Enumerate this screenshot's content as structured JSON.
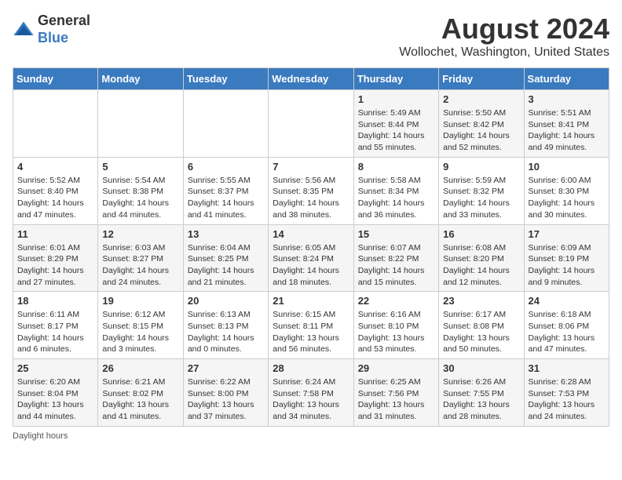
{
  "header": {
    "logo_line1": "General",
    "logo_line2": "Blue",
    "month_year": "August 2024",
    "location": "Wollochet, Washington, United States"
  },
  "weekdays": [
    "Sunday",
    "Monday",
    "Tuesday",
    "Wednesday",
    "Thursday",
    "Friday",
    "Saturday"
  ],
  "weeks": [
    [
      {
        "day": "",
        "info": ""
      },
      {
        "day": "",
        "info": ""
      },
      {
        "day": "",
        "info": ""
      },
      {
        "day": "",
        "info": ""
      },
      {
        "day": "1",
        "info": "Sunrise: 5:49 AM\nSunset: 8:44 PM\nDaylight: 14 hours\nand 55 minutes."
      },
      {
        "day": "2",
        "info": "Sunrise: 5:50 AM\nSunset: 8:42 PM\nDaylight: 14 hours\nand 52 minutes."
      },
      {
        "day": "3",
        "info": "Sunrise: 5:51 AM\nSunset: 8:41 PM\nDaylight: 14 hours\nand 49 minutes."
      }
    ],
    [
      {
        "day": "4",
        "info": "Sunrise: 5:52 AM\nSunset: 8:40 PM\nDaylight: 14 hours\nand 47 minutes."
      },
      {
        "day": "5",
        "info": "Sunrise: 5:54 AM\nSunset: 8:38 PM\nDaylight: 14 hours\nand 44 minutes."
      },
      {
        "day": "6",
        "info": "Sunrise: 5:55 AM\nSunset: 8:37 PM\nDaylight: 14 hours\nand 41 minutes."
      },
      {
        "day": "7",
        "info": "Sunrise: 5:56 AM\nSunset: 8:35 PM\nDaylight: 14 hours\nand 38 minutes."
      },
      {
        "day": "8",
        "info": "Sunrise: 5:58 AM\nSunset: 8:34 PM\nDaylight: 14 hours\nand 36 minutes."
      },
      {
        "day": "9",
        "info": "Sunrise: 5:59 AM\nSunset: 8:32 PM\nDaylight: 14 hours\nand 33 minutes."
      },
      {
        "day": "10",
        "info": "Sunrise: 6:00 AM\nSunset: 8:30 PM\nDaylight: 14 hours\nand 30 minutes."
      }
    ],
    [
      {
        "day": "11",
        "info": "Sunrise: 6:01 AM\nSunset: 8:29 PM\nDaylight: 14 hours\nand 27 minutes."
      },
      {
        "day": "12",
        "info": "Sunrise: 6:03 AM\nSunset: 8:27 PM\nDaylight: 14 hours\nand 24 minutes."
      },
      {
        "day": "13",
        "info": "Sunrise: 6:04 AM\nSunset: 8:25 PM\nDaylight: 14 hours\nand 21 minutes."
      },
      {
        "day": "14",
        "info": "Sunrise: 6:05 AM\nSunset: 8:24 PM\nDaylight: 14 hours\nand 18 minutes."
      },
      {
        "day": "15",
        "info": "Sunrise: 6:07 AM\nSunset: 8:22 PM\nDaylight: 14 hours\nand 15 minutes."
      },
      {
        "day": "16",
        "info": "Sunrise: 6:08 AM\nSunset: 8:20 PM\nDaylight: 14 hours\nand 12 minutes."
      },
      {
        "day": "17",
        "info": "Sunrise: 6:09 AM\nSunset: 8:19 PM\nDaylight: 14 hours\nand 9 minutes."
      }
    ],
    [
      {
        "day": "18",
        "info": "Sunrise: 6:11 AM\nSunset: 8:17 PM\nDaylight: 14 hours\nand 6 minutes."
      },
      {
        "day": "19",
        "info": "Sunrise: 6:12 AM\nSunset: 8:15 PM\nDaylight: 14 hours\nand 3 minutes."
      },
      {
        "day": "20",
        "info": "Sunrise: 6:13 AM\nSunset: 8:13 PM\nDaylight: 14 hours\nand 0 minutes."
      },
      {
        "day": "21",
        "info": "Sunrise: 6:15 AM\nSunset: 8:11 PM\nDaylight: 13 hours\nand 56 minutes."
      },
      {
        "day": "22",
        "info": "Sunrise: 6:16 AM\nSunset: 8:10 PM\nDaylight: 13 hours\nand 53 minutes."
      },
      {
        "day": "23",
        "info": "Sunrise: 6:17 AM\nSunset: 8:08 PM\nDaylight: 13 hours\nand 50 minutes."
      },
      {
        "day": "24",
        "info": "Sunrise: 6:18 AM\nSunset: 8:06 PM\nDaylight: 13 hours\nand 47 minutes."
      }
    ],
    [
      {
        "day": "25",
        "info": "Sunrise: 6:20 AM\nSunset: 8:04 PM\nDaylight: 13 hours\nand 44 minutes."
      },
      {
        "day": "26",
        "info": "Sunrise: 6:21 AM\nSunset: 8:02 PM\nDaylight: 13 hours\nand 41 minutes."
      },
      {
        "day": "27",
        "info": "Sunrise: 6:22 AM\nSunset: 8:00 PM\nDaylight: 13 hours\nand 37 minutes."
      },
      {
        "day": "28",
        "info": "Sunrise: 6:24 AM\nSunset: 7:58 PM\nDaylight: 13 hours\nand 34 minutes."
      },
      {
        "day": "29",
        "info": "Sunrise: 6:25 AM\nSunset: 7:56 PM\nDaylight: 13 hours\nand 31 minutes."
      },
      {
        "day": "30",
        "info": "Sunrise: 6:26 AM\nSunset: 7:55 PM\nDaylight: 13 hours\nand 28 minutes."
      },
      {
        "day": "31",
        "info": "Sunrise: 6:28 AM\nSunset: 7:53 PM\nDaylight: 13 hours\nand 24 minutes."
      }
    ]
  ],
  "footer": "Daylight hours"
}
